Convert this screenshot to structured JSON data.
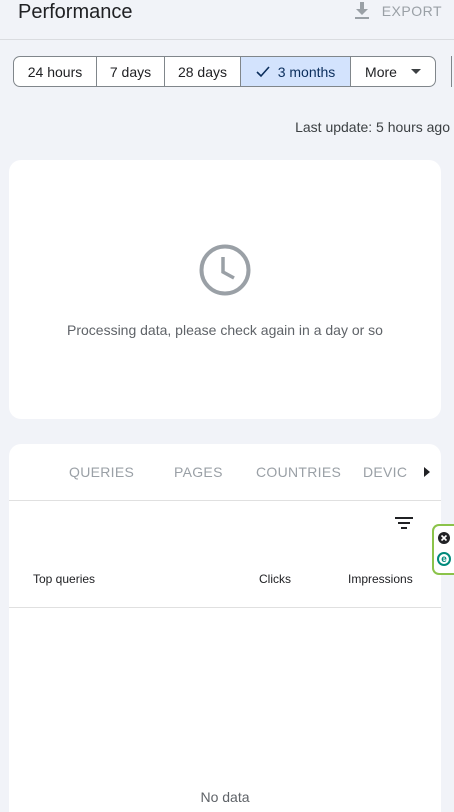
{
  "header": {
    "title": "Performance",
    "export_label": "EXPORT",
    "export_icon": "download-icon"
  },
  "date_range": {
    "options": [
      "24 hours",
      "7 days",
      "28 days",
      "3 months"
    ],
    "selected": "3 months",
    "more_label": "More"
  },
  "last_update": "Last update: 5 hours ago",
  "processing": {
    "icon": "clock-icon",
    "message": "Processing data, please check again in a day or so"
  },
  "table": {
    "tabs": [
      "QUERIES",
      "PAGES",
      "COUNTRIES",
      "DEVIC"
    ],
    "columns": [
      "Top queries",
      "Clicks",
      "Impressions"
    ],
    "empty_text": "No data"
  },
  "extension": {
    "close_icon": "close-circle-icon",
    "logo_letter": "e"
  },
  "colors": {
    "selected_chip_bg": "#d3e3fd",
    "page_bg": "#f1f3f8",
    "extension_border": "#8bc34a",
    "extension_accent": "#00897b"
  }
}
